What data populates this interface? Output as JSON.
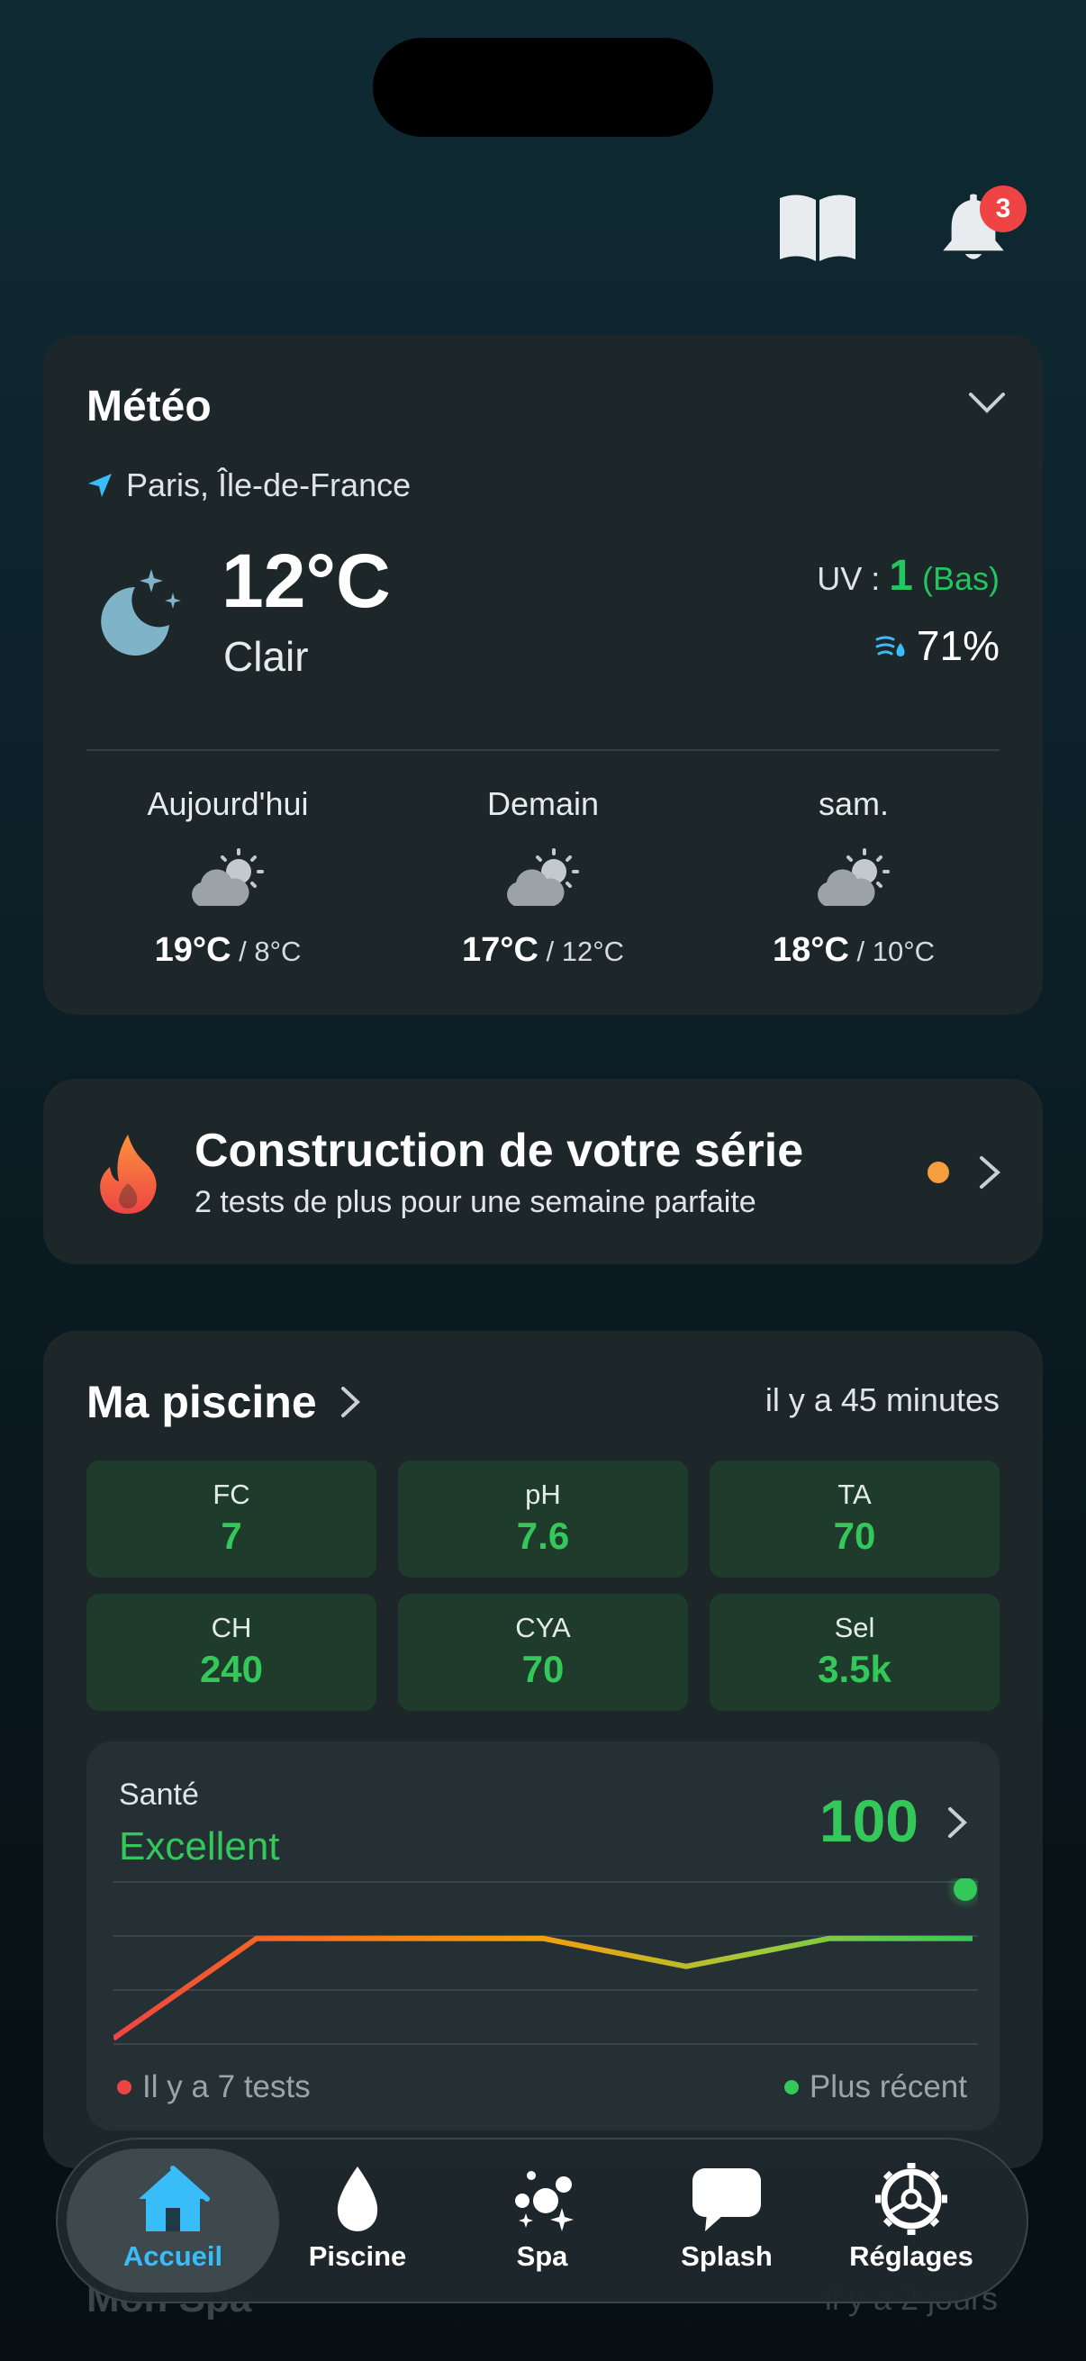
{
  "header": {
    "notification_count": "3",
    "icons": [
      "book-icon",
      "bell-icon"
    ]
  },
  "weather": {
    "title": "Météo",
    "location": "Paris, Île-de-France",
    "temperature": "12°C",
    "condition": "Clair",
    "uv_label": "UV :",
    "uv_value": "1",
    "uv_level": "(Bas)",
    "humidity": "71%",
    "forecast": [
      {
        "day": "Aujourd'hui",
        "high": "19°C",
        "low": "8°C"
      },
      {
        "day": "Demain",
        "high": "17°C",
        "low": "12°C"
      },
      {
        "day": "sam.",
        "high": "18°C",
        "low": "10°C"
      }
    ]
  },
  "streak": {
    "title": "Construction de votre série",
    "subtitle": "2 tests de plus pour une semaine parfaite"
  },
  "pool": {
    "title": "Ma piscine",
    "last_update": "il y a 45 minutes",
    "metrics": [
      {
        "key": "FC",
        "value": "7"
      },
      {
        "key": "pH",
        "value": "7.6"
      },
      {
        "key": "TA",
        "value": "70"
      },
      {
        "key": "CH",
        "value": "240"
      },
      {
        "key": "CYA",
        "value": "70"
      },
      {
        "key": "Sel",
        "value": "3.5k"
      }
    ],
    "health": {
      "label": "Santé",
      "status": "Excellent",
      "score": "100",
      "legend_old": "Il y a 7 tests",
      "legend_new": "Plus récent"
    }
  },
  "chart_data": {
    "type": "line",
    "x": [
      1,
      2,
      3,
      4,
      5,
      6,
      7
    ],
    "values": [
      60,
      85,
      85,
      85,
      78,
      85,
      85
    ],
    "latest": 100,
    "ylim": [
      55,
      100
    ]
  },
  "spa_ghost": {
    "title": "Mon Spa",
    "time": "il y a 2 jours"
  },
  "nav": {
    "items": [
      {
        "label": "Accueil"
      },
      {
        "label": "Piscine"
      },
      {
        "label": "Spa"
      },
      {
        "label": "Splash"
      },
      {
        "label": "Réglages"
      }
    ]
  },
  "colors": {
    "accent": "#38bdf8",
    "good": "#34c759",
    "warn": "#f59e3b",
    "bad": "#ef4444"
  }
}
